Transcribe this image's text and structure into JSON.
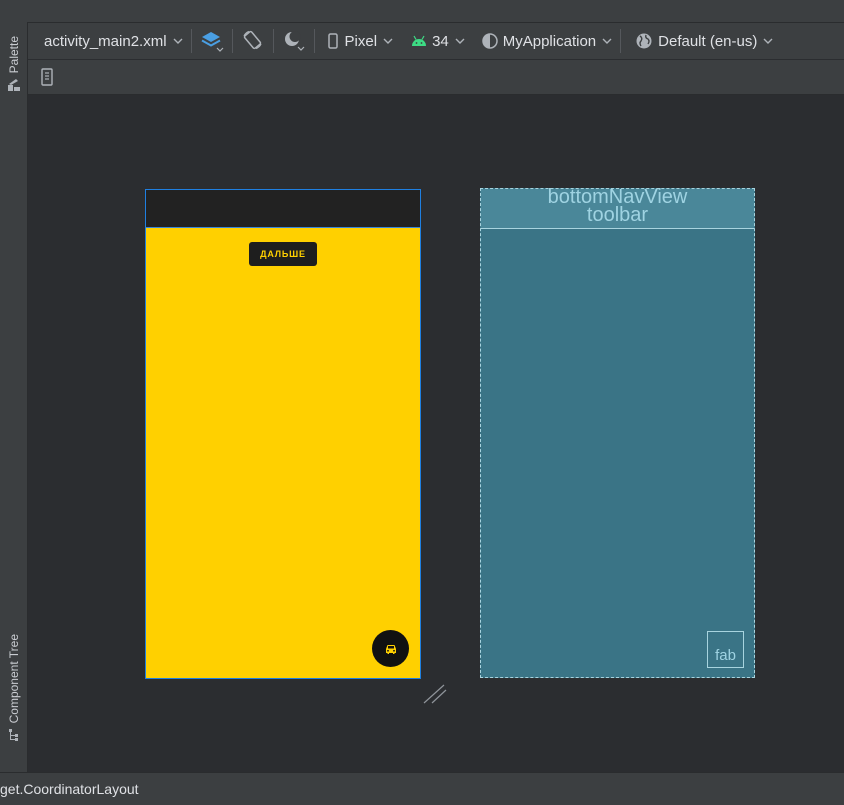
{
  "palette_label": "Palette",
  "component_tree_label": "Component Tree",
  "toolbar": {
    "file": "activity_main2.xml",
    "device": "Pixel",
    "api": "34",
    "theme": "MyApplication",
    "locale": "Default (en-us)"
  },
  "design": {
    "button_label": "ДАЛЬШЕ"
  },
  "blueprint": {
    "bottom_nav_label": "bottomNavView",
    "toolbar_label": "toolbar",
    "fab_label": "fab"
  },
  "status_text": "get.CoordinatorLayout",
  "colors": {
    "screen": "#ffd000",
    "appbar": "#222222",
    "blueprint": "#3a7486",
    "android_green": "#3ddc84"
  }
}
